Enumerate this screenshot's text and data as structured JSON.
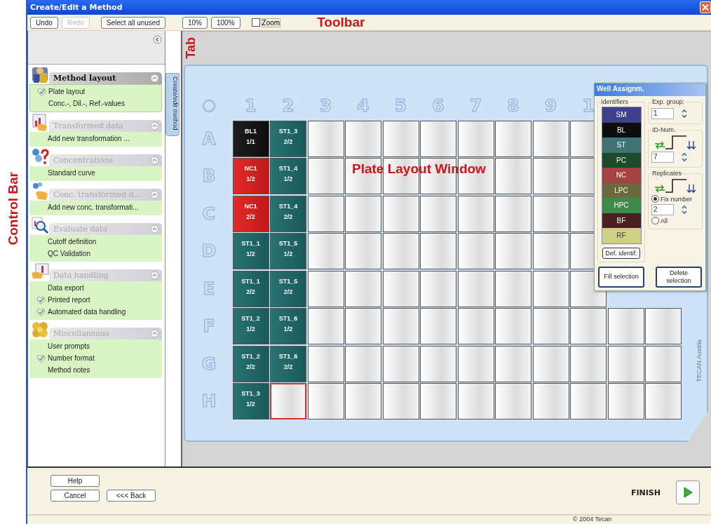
{
  "window": {
    "title": "Create/Edit a Method"
  },
  "toolbar": {
    "button_groups": [
      [
        {
          "label": "Undo",
          "disabled": false
        },
        {
          "label": "Redo",
          "disabled": true
        }
      ],
      [
        {
          "label": "Select all unused",
          "disabled": false
        }
      ],
      [
        {
          "label": "10%",
          "disabled": false
        },
        {
          "label": "100%",
          "disabled": false
        }
      ]
    ],
    "zoom": {
      "label": "Zoom",
      "checked": false
    }
  },
  "annotations": [
    {
      "text": "Toolbar"
    },
    {
      "text": "Tab"
    },
    {
      "text": "Control Bar"
    },
    {
      "text": "Plate Layout Window"
    }
  ],
  "sidebar": {
    "sections": [
      {
        "title": "Method layout",
        "selected": true,
        "items": [
          {
            "label": "Plate layout",
            "checked": true
          },
          {
            "label": "Conc.-, Dil.-, Ref.-values",
            "checked": false
          }
        ]
      },
      {
        "title": "Transformed data",
        "selected": false,
        "items": [
          {
            "label": "Add new transformation ...",
            "checked": false
          }
        ]
      },
      {
        "title": "Concentrations",
        "selected": false,
        "items": [
          {
            "label": "Standard curve",
            "checked": false
          }
        ]
      },
      {
        "title": "Conc. transformed d...",
        "selected": false,
        "items": [
          {
            "label": "Add new conc. transformati...",
            "checked": false
          }
        ]
      },
      {
        "title": "Evaluate data",
        "selected": false,
        "items": [
          {
            "label": "Cutoff definition",
            "checked": false
          },
          {
            "label": "QC Validation",
            "checked": false
          }
        ]
      },
      {
        "title": "Data handling",
        "selected": false,
        "items": [
          {
            "label": "Data export",
            "checked": false
          },
          {
            "label": "Printed report",
            "checked": true
          },
          {
            "label": "Automated data handling",
            "checked": true
          }
        ]
      },
      {
        "title": "Miscellaneous",
        "selected": false,
        "items": [
          {
            "label": "User prompts",
            "checked": false
          },
          {
            "label": "Number format",
            "checked": true
          },
          {
            "label": "Method notes",
            "checked": false
          }
        ]
      }
    ]
  },
  "side_tabs": [
    {
      "label": "Create/edit method",
      "selected": true
    }
  ],
  "plate": {
    "column_headers": [
      "1",
      "2",
      "3",
      "4",
      "5",
      "6",
      "7",
      "8",
      "9",
      "1"
    ],
    "brand": "TECAN Austria",
    "rows": [
      {
        "label": "A",
        "wells": [
          {
            "kind": "sample",
            "name": "BL1",
            "replicate": "1/1",
            "color": "#111111",
            "selected": false
          },
          {
            "kind": "sample",
            "name": "ST1_3",
            "replicate": "2/2",
            "color": "#1d6a6a",
            "selected": false
          },
          {
            "kind": "empty",
            "selected": false
          },
          {
            "kind": "empty",
            "selected": false
          },
          {
            "kind": "empty",
            "selected": false
          },
          {
            "kind": "empty",
            "selected": false
          },
          {
            "kind": "empty",
            "selected": false
          },
          {
            "kind": "empty",
            "selected": false
          },
          {
            "kind": "empty",
            "selected": false
          },
          {
            "kind": "empty",
            "selected": false
          }
        ]
      },
      {
        "label": "B",
        "wells": [
          {
            "kind": "sample",
            "name": "NC1",
            "replicate": "1/2",
            "color": "#e21d1d",
            "selected": false
          },
          {
            "kind": "sample",
            "name": "ST1_4",
            "replicate": "1/2",
            "color": "#1d6a6a",
            "selected": false
          },
          {
            "kind": "empty",
            "selected": false
          },
          {
            "kind": "empty",
            "selected": false
          },
          {
            "kind": "empty",
            "selected": false
          },
          {
            "kind": "empty",
            "selected": false
          },
          {
            "kind": "empty",
            "selected": false
          },
          {
            "kind": "empty",
            "selected": false
          },
          {
            "kind": "empty",
            "selected": false
          },
          {
            "kind": "empty",
            "selected": false
          }
        ]
      },
      {
        "label": "C",
        "wells": [
          {
            "kind": "sample",
            "name": "NC1",
            "replicate": "2/2",
            "color": "#e21d1d",
            "selected": false
          },
          {
            "kind": "sample",
            "name": "ST1_4",
            "replicate": "2/2",
            "color": "#1d6a6a",
            "selected": false
          },
          {
            "kind": "empty",
            "selected": false
          },
          {
            "kind": "empty",
            "selected": false
          },
          {
            "kind": "empty",
            "selected": false
          },
          {
            "kind": "empty",
            "selected": false
          },
          {
            "kind": "empty",
            "selected": false
          },
          {
            "kind": "empty",
            "selected": false
          },
          {
            "kind": "empty",
            "selected": false
          },
          {
            "kind": "empty",
            "selected": false
          }
        ]
      },
      {
        "label": "D",
        "wells": [
          {
            "kind": "sample",
            "name": "ST1_1",
            "replicate": "1/2",
            "color": "#1d6a6a",
            "selected": false
          },
          {
            "kind": "sample",
            "name": "ST1_5",
            "replicate": "1/2",
            "color": "#1d6a6a",
            "selected": false
          },
          {
            "kind": "empty",
            "selected": false
          },
          {
            "kind": "empty",
            "selected": false
          },
          {
            "kind": "empty",
            "selected": false
          },
          {
            "kind": "empty",
            "selected": false
          },
          {
            "kind": "empty",
            "selected": false
          },
          {
            "kind": "empty",
            "selected": false
          },
          {
            "kind": "empty",
            "selected": false
          },
          {
            "kind": "empty",
            "selected": false
          }
        ]
      },
      {
        "label": "E",
        "wells": [
          {
            "kind": "sample",
            "name": "ST1_1",
            "replicate": "2/2",
            "color": "#1d6a6a",
            "selected": false
          },
          {
            "kind": "sample",
            "name": "ST1_5",
            "replicate": "2/2",
            "color": "#1d6a6a",
            "selected": false
          },
          {
            "kind": "empty",
            "selected": false
          },
          {
            "kind": "empty",
            "selected": false
          },
          {
            "kind": "empty",
            "selected": false
          },
          {
            "kind": "empty",
            "selected": false
          },
          {
            "kind": "empty",
            "selected": false
          },
          {
            "kind": "empty",
            "selected": false
          },
          {
            "kind": "empty",
            "selected": false
          },
          {
            "kind": "empty",
            "selected": false
          }
        ]
      },
      {
        "label": "F",
        "wells": [
          {
            "kind": "sample",
            "name": "ST1_2",
            "replicate": "1/2",
            "color": "#1d6a6a",
            "selected": false
          },
          {
            "kind": "sample",
            "name": "ST1_6",
            "replicate": "1/2",
            "color": "#1d6a6a",
            "selected": false
          },
          {
            "kind": "empty",
            "selected": false
          },
          {
            "kind": "empty",
            "selected": false
          },
          {
            "kind": "empty",
            "selected": false
          },
          {
            "kind": "empty",
            "selected": false
          },
          {
            "kind": "empty",
            "selected": false
          },
          {
            "kind": "empty",
            "selected": false
          },
          {
            "kind": "empty",
            "selected": false
          },
          {
            "kind": "empty",
            "selected": false
          },
          {
            "kind": "empty",
            "selected": false
          },
          {
            "kind": "empty",
            "selected": false
          }
        ]
      },
      {
        "label": "G",
        "wells": [
          {
            "kind": "sample",
            "name": "ST1_2",
            "replicate": "2/2",
            "color": "#1d6a6a",
            "selected": false
          },
          {
            "kind": "sample",
            "name": "ST1_6",
            "replicate": "2/2",
            "color": "#1d6a6a",
            "selected": false
          },
          {
            "kind": "empty",
            "selected": false
          },
          {
            "kind": "empty",
            "selected": false
          },
          {
            "kind": "empty",
            "selected": false
          },
          {
            "kind": "empty",
            "selected": false
          },
          {
            "kind": "empty",
            "selected": false
          },
          {
            "kind": "empty",
            "selected": false
          },
          {
            "kind": "empty",
            "selected": false
          },
          {
            "kind": "empty",
            "selected": false
          },
          {
            "kind": "empty",
            "selected": false
          },
          {
            "kind": "empty",
            "selected": false
          }
        ]
      },
      {
        "label": "H",
        "wells": [
          {
            "kind": "sample",
            "name": "ST1_3",
            "replicate": "1/2",
            "color": "#1d6a6a",
            "selected": false
          },
          {
            "kind": "empty",
            "selected": true
          },
          {
            "kind": "empty",
            "selected": false
          },
          {
            "kind": "empty",
            "selected": false
          },
          {
            "kind": "empty",
            "selected": false
          },
          {
            "kind": "empty",
            "selected": false
          },
          {
            "kind": "empty",
            "selected": false
          },
          {
            "kind": "empty",
            "selected": false
          },
          {
            "kind": "empty",
            "selected": false
          },
          {
            "kind": "empty",
            "selected": false
          },
          {
            "kind": "empty",
            "selected": false
          },
          {
            "kind": "empty",
            "selected": false
          }
        ]
      }
    ]
  },
  "well_assignment": {
    "title": "Well Assignm.",
    "identifiers_label": "Identifiers",
    "identifiers": [
      {
        "label": "SM",
        "color": "#3f3f8f"
      },
      {
        "label": "BL",
        "color": "#0d0d0d"
      },
      {
        "label": "ST",
        "color": "#3e7574"
      },
      {
        "label": "PC",
        "color": "#1f4a29"
      },
      {
        "label": "NC",
        "color": "#a54343"
      },
      {
        "label": "LPC",
        "color": "#6a6b3d"
      },
      {
        "label": "HPC",
        "color": "#3d8b48"
      },
      {
        "label": "BF",
        "color": "#4a2020"
      },
      {
        "label": "RF",
        "color": "#cfcf86"
      }
    ],
    "define_button": "Def. identif.",
    "exp_group": {
      "label": "Exp. group:",
      "value": "1"
    },
    "id_num": {
      "label": "ID-Num.",
      "value": "7"
    },
    "replicates": {
      "label": "Replicates",
      "options": [
        {
          "label": "Fix number",
          "selected": true
        },
        {
          "label": "All",
          "selected": false
        }
      ],
      "value": "2"
    },
    "buttons": [
      "Fill selection",
      "Delete selection"
    ]
  },
  "footer": {
    "buttons": [
      {
        "label": "Help"
      },
      {
        "label": "Cancel"
      },
      {
        "label": "<<< Back"
      }
    ],
    "finish": "FINISH"
  },
  "status_bar": {
    "text": "© 2004 Tecan"
  }
}
